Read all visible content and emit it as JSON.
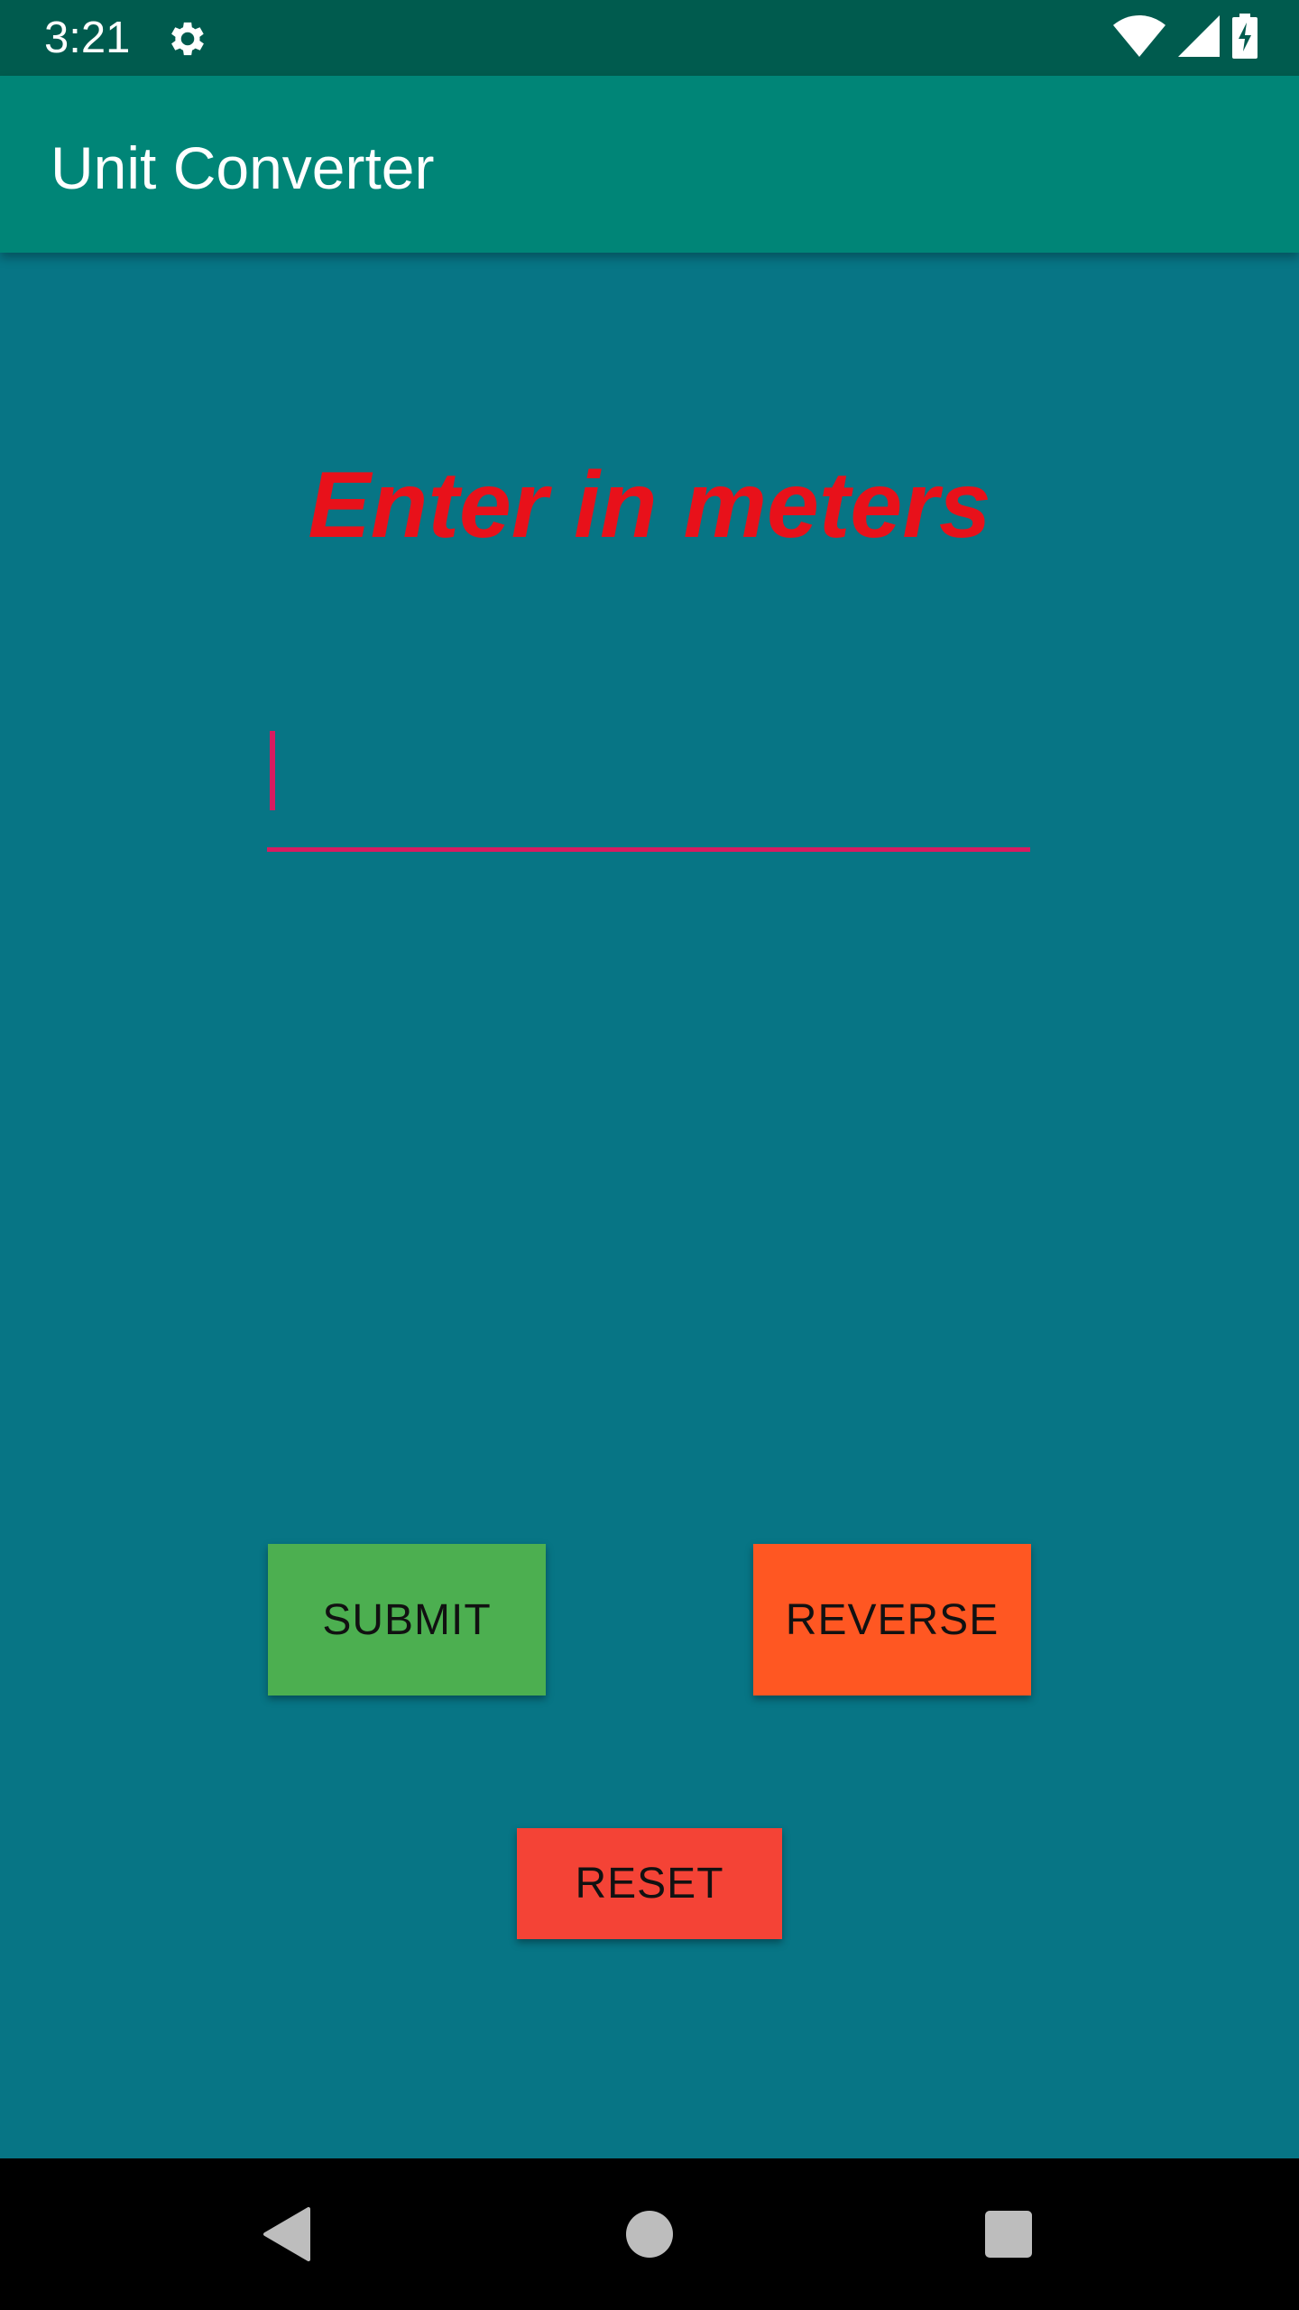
{
  "status_bar": {
    "time": "3:21",
    "icons": [
      "settings-icon",
      "wifi-icon",
      "cell-signal-icon",
      "battery-charging-icon"
    ]
  },
  "app_bar": {
    "title": "Unit Converter"
  },
  "main": {
    "prompt": "Enter in meters",
    "input": {
      "value": "",
      "placeholder": ""
    },
    "buttons": {
      "submit": "SUBMIT",
      "reverse": "REVERSE",
      "reset": "RESET"
    }
  },
  "nav_bar": {
    "icons": [
      "back-icon",
      "home-icon",
      "recents-icon"
    ]
  },
  "colors": {
    "status_bar": "#005B4E",
    "app_bar": "#008577",
    "background": "#077585",
    "prompt_text": "#E8111A",
    "input_accent": "#D81B60",
    "submit_button": "#4CAF50",
    "reverse_button": "#FF5722",
    "reset_button": "#F44336",
    "nav_bar": "#000000"
  }
}
